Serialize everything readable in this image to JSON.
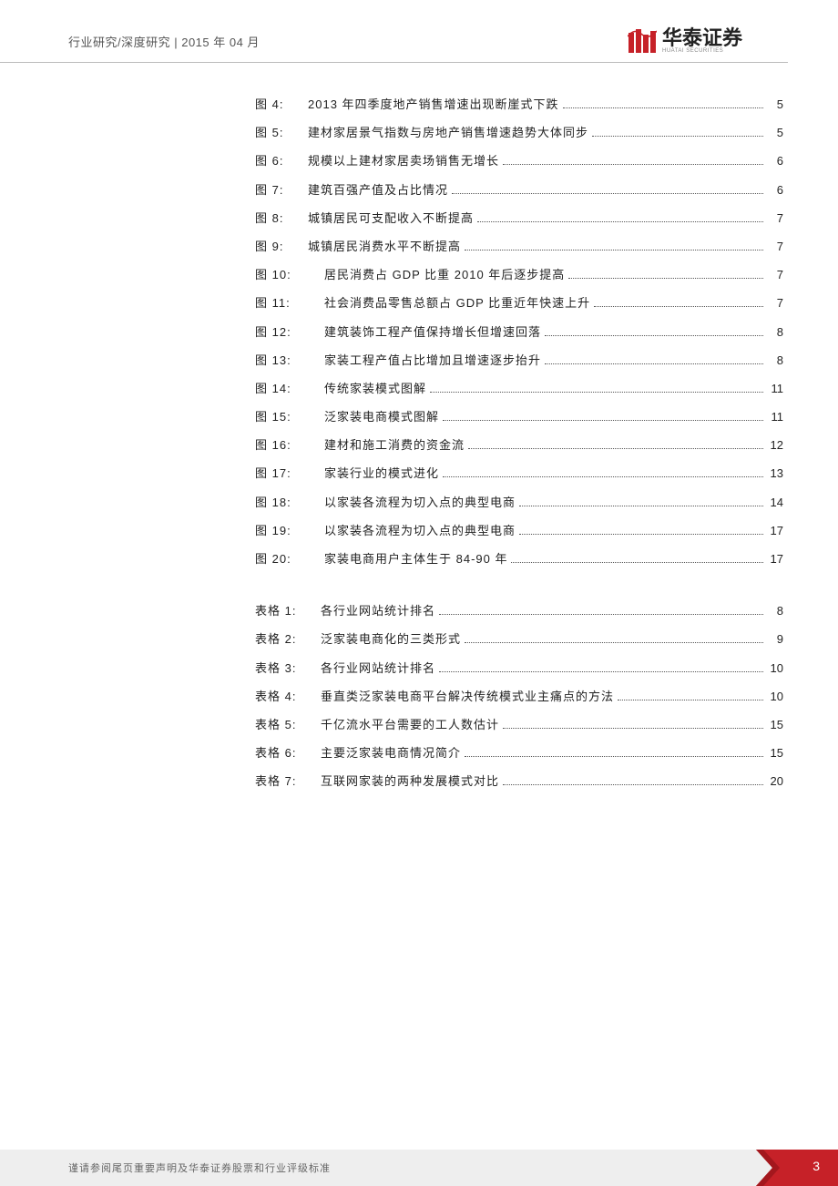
{
  "header": {
    "breadcrumb": "行业研究/深度研究 | 2015 年 04 月",
    "brand_name": "华泰证券",
    "brand_sub": "HUATAI SECURITIES"
  },
  "toc": {
    "figures": [
      {
        "label": "图 4:",
        "title": "2013 年四季度地产销售增速出现断崖式下跌",
        "page": "5",
        "indent": false
      },
      {
        "label": "图 5:",
        "title": "建材家居景气指数与房地产销售增速趋势大体同步",
        "page": "5",
        "indent": false
      },
      {
        "label": "图 6:",
        "title": "规模以上建材家居卖场销售无增长",
        "page": "6",
        "indent": false
      },
      {
        "label": "图 7:",
        "title": "建筑百强产值及占比情况",
        "page": "6",
        "indent": false
      },
      {
        "label": "图 8:",
        "title": "城镇居民可支配收入不断提高",
        "page": "7",
        "indent": false
      },
      {
        "label": "图 9:",
        "title": "城镇居民消费水平不断提高",
        "page": "7",
        "indent": false
      },
      {
        "label": "图 10:",
        "title": "居民消费占 GDP 比重 2010 年后逐步提高",
        "page": "7",
        "indent": true
      },
      {
        "label": "图 11:",
        "title": "社会消费品零售总额占 GDP 比重近年快速上升",
        "page": "7",
        "indent": true
      },
      {
        "label": "图 12:",
        "title": "建筑装饰工程产值保持增长但增速回落",
        "page": "8",
        "indent": true
      },
      {
        "label": "图 13:",
        "title": "家装工程产值占比增加且增速逐步抬升",
        "page": "8",
        "indent": true
      },
      {
        "label": "图 14:",
        "title": "传统家装模式图解",
        "page": "11",
        "indent": true
      },
      {
        "label": "图 15:",
        "title": "泛家装电商模式图解",
        "page": "11",
        "indent": true
      },
      {
        "label": "图 16:",
        "title": "建材和施工消费的资金流",
        "page": "12",
        "indent": true
      },
      {
        "label": "图 17:",
        "title": "家装行业的模式进化",
        "page": "13",
        "indent": true
      },
      {
        "label": "图 18:",
        "title": "以家装各流程为切入点的典型电商",
        "page": "14",
        "indent": true
      },
      {
        "label": "图 19:",
        "title": "以家装各流程为切入点的典型电商",
        "page": "17",
        "indent": true
      },
      {
        "label": "图 20:",
        "title": "家装电商用户主体生于 84-90 年",
        "page": "17",
        "indent": true
      }
    ],
    "tables": [
      {
        "label": "表格 1:",
        "title": "各行业网站统计排名",
        "page": "8"
      },
      {
        "label": "表格 2:",
        "title": "泛家装电商化的三类形式",
        "page": "9"
      },
      {
        "label": "表格 3:",
        "title": "各行业网站统计排名",
        "page": "10"
      },
      {
        "label": "表格 4:",
        "title": "垂直类泛家装电商平台解决传统模式业主痛点的方法",
        "page": "10"
      },
      {
        "label": "表格 5:",
        "title": "千亿流水平台需要的工人数估计",
        "page": "15"
      },
      {
        "label": "表格 6:",
        "title": "主要泛家装电商情况简介",
        "page": "15"
      },
      {
        "label": "表格 7:",
        "title": "互联网家装的两种发展模式对比",
        "page": "20"
      }
    ]
  },
  "footer": {
    "disclaimer": "谨请参阅尾页重要声明及华泰证券股票和行业评级标准",
    "page_number": "3"
  },
  "colors": {
    "brand_red": "#c62128",
    "footer_gray": "#eeeeee"
  }
}
